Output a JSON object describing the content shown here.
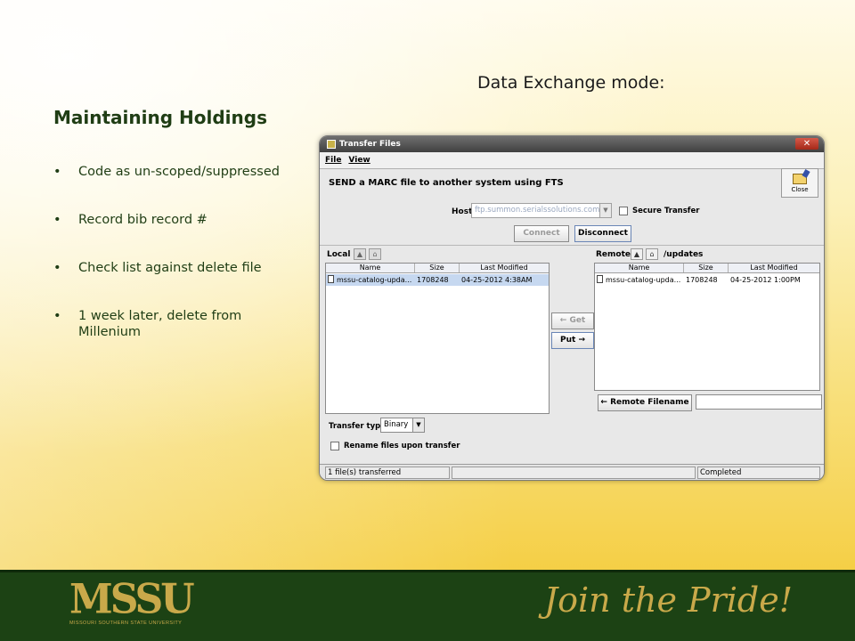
{
  "slide": {
    "subtitle": "Data Exchange mode:",
    "title": "Maintaining Holdings",
    "bullets": [
      "Code as un-scoped/suppressed",
      "Record bib record #",
      "Check list against delete file",
      "1 week later, delete from Millenium"
    ]
  },
  "window": {
    "title": "Transfer Files",
    "close_x": "✕",
    "menu": [
      "File",
      "View"
    ],
    "heading": "SEND a MARC file to another system using FTS",
    "close_button_label": "Close",
    "host_label": "Host",
    "host_value": "ftp.summon.serialssolutions.com",
    "secure_transfer_label": "Secure Transfer",
    "connect_label": "Connect",
    "disconnect_label": "Disconnect",
    "local": {
      "label": "Local",
      "columns": [
        "Name",
        "Size",
        "Last Modified"
      ],
      "rows": [
        {
          "name": "mssu-catalog-upda...",
          "size": "1708248",
          "modified": "04-25-2012 4:38AM"
        }
      ]
    },
    "remote": {
      "label": "Remote",
      "path": "/updates",
      "columns": [
        "Name",
        "Size",
        "Last Modified"
      ],
      "rows": [
        {
          "name": "mssu-catalog-upda...",
          "size": "1708248",
          "modified": "04-25-2012 1:00PM"
        }
      ]
    },
    "get_label": "← Get",
    "put_label": "Put →",
    "remote_filename_label": "← Remote Filename",
    "transfer_type_label": "Transfer type:",
    "transfer_type_value": "Binary",
    "rename_label": "Rename files upon transfer",
    "status_left": "1 file(s) transferred",
    "status_mid": "",
    "status_right": "Completed"
  },
  "footer": {
    "logo_text": "MSSU",
    "logo_subtext": "MISSOURI SOUTHERN STATE UNIVERSITY",
    "tagline": "Join the Pride!"
  },
  "colors": {
    "footer_bg": "#1c4214",
    "gold": "#c9a94a",
    "title_green": "#1f3d14"
  }
}
